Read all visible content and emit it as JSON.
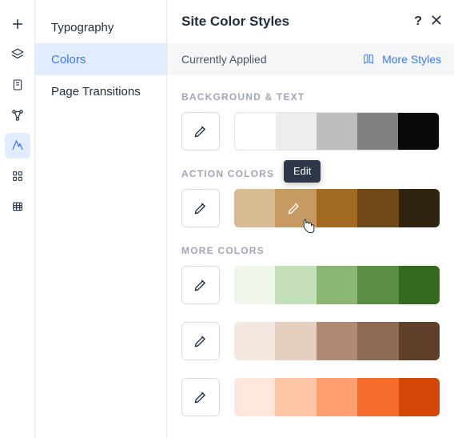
{
  "rail": {
    "items": [
      "add",
      "layers",
      "page",
      "connections",
      "design",
      "apps",
      "tables"
    ],
    "active": "design"
  },
  "sidebar": {
    "items": [
      {
        "label": "Typography"
      },
      {
        "label": "Colors"
      },
      {
        "label": "Page Transitions"
      }
    ],
    "activeIndex": 1
  },
  "panel": {
    "title": "Site Color Styles",
    "applied_label": "Currently Applied",
    "more_styles_label": "More Styles"
  },
  "sections": {
    "background": {
      "label": "BACKGROUND & TEXT",
      "colors": [
        "#ffffff",
        "#ededed",
        "#bdbdbd",
        "#808080",
        "#0a0a0a"
      ]
    },
    "action": {
      "label": "ACTION COLORS",
      "colors": [
        "#d7bb93",
        "#c69a62",
        "#a36a23",
        "#6e4917",
        "#2f2210"
      ],
      "tooltip": "Edit"
    },
    "more": {
      "label": "MORE COLORS",
      "rows": [
        [
          "#eef6ea",
          "#c4dfba",
          "#8ab572",
          "#5a8e43",
          "#346a1f"
        ],
        [
          "#f3e8df",
          "#e5cfc0",
          "#b08a75",
          "#8e6b55",
          "#5e3f2a"
        ],
        [
          "#ffe8db",
          "#ffc7a6",
          "#ff9e6e",
          "#f46b2c",
          "#d24708"
        ]
      ]
    }
  }
}
